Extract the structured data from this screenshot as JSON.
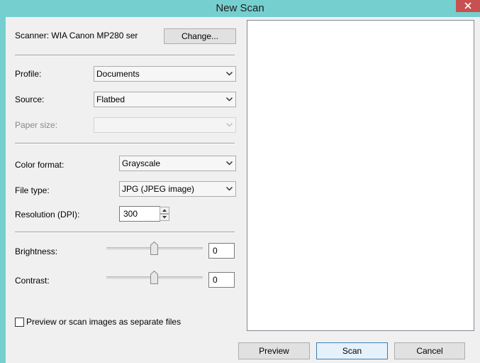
{
  "window": {
    "title": "New Scan"
  },
  "scanner": {
    "label": "Scanner: WIA Canon MP280 ser",
    "change_label": "Change..."
  },
  "profile": {
    "label": "Profile:",
    "value": "Documents"
  },
  "source": {
    "label": "Source:",
    "value": "Flatbed"
  },
  "paper_size": {
    "label": "Paper size:",
    "value": ""
  },
  "color_format": {
    "label": "Color format:",
    "value": "Grayscale"
  },
  "file_type": {
    "label": "File type:",
    "value": "JPG (JPEG image)"
  },
  "resolution": {
    "label": "Resolution (DPI):",
    "value": "300"
  },
  "brightness": {
    "label": "Brightness:",
    "value": "0"
  },
  "contrast": {
    "label": "Contrast:",
    "value": "0"
  },
  "separate_files": {
    "label": "Preview or scan images as separate files",
    "checked": false
  },
  "buttons": {
    "preview": "Preview",
    "scan": "Scan",
    "cancel": "Cancel"
  },
  "icons": {
    "close": "close-icon",
    "dropdown": "chevron-down-icon",
    "spin_up": "spin-up-icon",
    "spin_down": "spin-down-icon",
    "slider_thumb": "slider-thumb-icon"
  },
  "colors": {
    "frame": "#76CFCF",
    "close_button": "#C75050",
    "dialog_bg": "#F0F0F0",
    "default_button_border": "#3C7FB1"
  }
}
